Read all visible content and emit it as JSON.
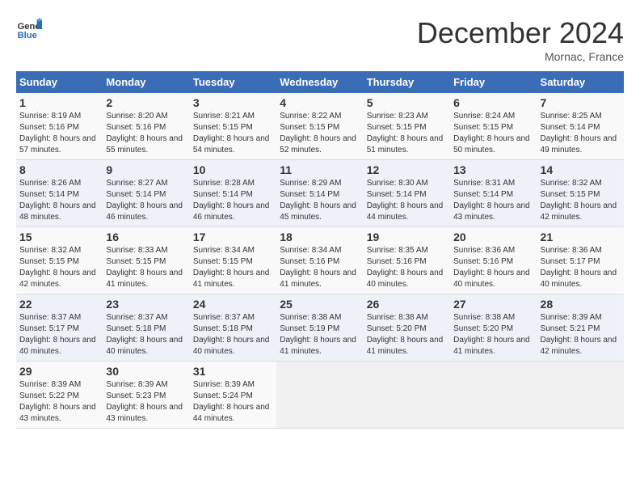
{
  "header": {
    "logo_line1": "General",
    "logo_line2": "Blue",
    "month": "December 2024",
    "location": "Mornac, France"
  },
  "days_of_week": [
    "Sunday",
    "Monday",
    "Tuesday",
    "Wednesday",
    "Thursday",
    "Friday",
    "Saturday"
  ],
  "weeks": [
    [
      {
        "day": "1",
        "sunrise": "Sunrise: 8:19 AM",
        "sunset": "Sunset: 5:16 PM",
        "daylight": "Daylight: 8 hours and 57 minutes."
      },
      {
        "day": "2",
        "sunrise": "Sunrise: 8:20 AM",
        "sunset": "Sunset: 5:16 PM",
        "daylight": "Daylight: 8 hours and 55 minutes."
      },
      {
        "day": "3",
        "sunrise": "Sunrise: 8:21 AM",
        "sunset": "Sunset: 5:15 PM",
        "daylight": "Daylight: 8 hours and 54 minutes."
      },
      {
        "day": "4",
        "sunrise": "Sunrise: 8:22 AM",
        "sunset": "Sunset: 5:15 PM",
        "daylight": "Daylight: 8 hours and 52 minutes."
      },
      {
        "day": "5",
        "sunrise": "Sunrise: 8:23 AM",
        "sunset": "Sunset: 5:15 PM",
        "daylight": "Daylight: 8 hours and 51 minutes."
      },
      {
        "day": "6",
        "sunrise": "Sunrise: 8:24 AM",
        "sunset": "Sunset: 5:15 PM",
        "daylight": "Daylight: 8 hours and 50 minutes."
      },
      {
        "day": "7",
        "sunrise": "Sunrise: 8:25 AM",
        "sunset": "Sunset: 5:14 PM",
        "daylight": "Daylight: 8 hours and 49 minutes."
      }
    ],
    [
      {
        "day": "8",
        "sunrise": "Sunrise: 8:26 AM",
        "sunset": "Sunset: 5:14 PM",
        "daylight": "Daylight: 8 hours and 48 minutes."
      },
      {
        "day": "9",
        "sunrise": "Sunrise: 8:27 AM",
        "sunset": "Sunset: 5:14 PM",
        "daylight": "Daylight: 8 hours and 46 minutes."
      },
      {
        "day": "10",
        "sunrise": "Sunrise: 8:28 AM",
        "sunset": "Sunset: 5:14 PM",
        "daylight": "Daylight: 8 hours and 46 minutes."
      },
      {
        "day": "11",
        "sunrise": "Sunrise: 8:29 AM",
        "sunset": "Sunset: 5:14 PM",
        "daylight": "Daylight: 8 hours and 45 minutes."
      },
      {
        "day": "12",
        "sunrise": "Sunrise: 8:30 AM",
        "sunset": "Sunset: 5:14 PM",
        "daylight": "Daylight: 8 hours and 44 minutes."
      },
      {
        "day": "13",
        "sunrise": "Sunrise: 8:31 AM",
        "sunset": "Sunset: 5:14 PM",
        "daylight": "Daylight: 8 hours and 43 minutes."
      },
      {
        "day": "14",
        "sunrise": "Sunrise: 8:32 AM",
        "sunset": "Sunset: 5:15 PM",
        "daylight": "Daylight: 8 hours and 42 minutes."
      }
    ],
    [
      {
        "day": "15",
        "sunrise": "Sunrise: 8:32 AM",
        "sunset": "Sunset: 5:15 PM",
        "daylight": "Daylight: 8 hours and 42 minutes."
      },
      {
        "day": "16",
        "sunrise": "Sunrise: 8:33 AM",
        "sunset": "Sunset: 5:15 PM",
        "daylight": "Daylight: 8 hours and 41 minutes."
      },
      {
        "day": "17",
        "sunrise": "Sunrise: 8:34 AM",
        "sunset": "Sunset: 5:15 PM",
        "daylight": "Daylight: 8 hours and 41 minutes."
      },
      {
        "day": "18",
        "sunrise": "Sunrise: 8:34 AM",
        "sunset": "Sunset: 5:16 PM",
        "daylight": "Daylight: 8 hours and 41 minutes."
      },
      {
        "day": "19",
        "sunrise": "Sunrise: 8:35 AM",
        "sunset": "Sunset: 5:16 PM",
        "daylight": "Daylight: 8 hours and 40 minutes."
      },
      {
        "day": "20",
        "sunrise": "Sunrise: 8:36 AM",
        "sunset": "Sunset: 5:16 PM",
        "daylight": "Daylight: 8 hours and 40 minutes."
      },
      {
        "day": "21",
        "sunrise": "Sunrise: 8:36 AM",
        "sunset": "Sunset: 5:17 PM",
        "daylight": "Daylight: 8 hours and 40 minutes."
      }
    ],
    [
      {
        "day": "22",
        "sunrise": "Sunrise: 8:37 AM",
        "sunset": "Sunset: 5:17 PM",
        "daylight": "Daylight: 8 hours and 40 minutes."
      },
      {
        "day": "23",
        "sunrise": "Sunrise: 8:37 AM",
        "sunset": "Sunset: 5:18 PM",
        "daylight": "Daylight: 8 hours and 40 minutes."
      },
      {
        "day": "24",
        "sunrise": "Sunrise: 8:37 AM",
        "sunset": "Sunset: 5:18 PM",
        "daylight": "Daylight: 8 hours and 40 minutes."
      },
      {
        "day": "25",
        "sunrise": "Sunrise: 8:38 AM",
        "sunset": "Sunset: 5:19 PM",
        "daylight": "Daylight: 8 hours and 41 minutes."
      },
      {
        "day": "26",
        "sunrise": "Sunrise: 8:38 AM",
        "sunset": "Sunset: 5:20 PM",
        "daylight": "Daylight: 8 hours and 41 minutes."
      },
      {
        "day": "27",
        "sunrise": "Sunrise: 8:38 AM",
        "sunset": "Sunset: 5:20 PM",
        "daylight": "Daylight: 8 hours and 41 minutes."
      },
      {
        "day": "28",
        "sunrise": "Sunrise: 8:39 AM",
        "sunset": "Sunset: 5:21 PM",
        "daylight": "Daylight: 8 hours and 42 minutes."
      }
    ],
    [
      {
        "day": "29",
        "sunrise": "Sunrise: 8:39 AM",
        "sunset": "Sunset: 5:22 PM",
        "daylight": "Daylight: 8 hours and 43 minutes."
      },
      {
        "day": "30",
        "sunrise": "Sunrise: 8:39 AM",
        "sunset": "Sunset: 5:23 PM",
        "daylight": "Daylight: 8 hours and 43 minutes."
      },
      {
        "day": "31",
        "sunrise": "Sunrise: 8:39 AM",
        "sunset": "Sunset: 5:24 PM",
        "daylight": "Daylight: 8 hours and 44 minutes."
      },
      null,
      null,
      null,
      null
    ]
  ]
}
